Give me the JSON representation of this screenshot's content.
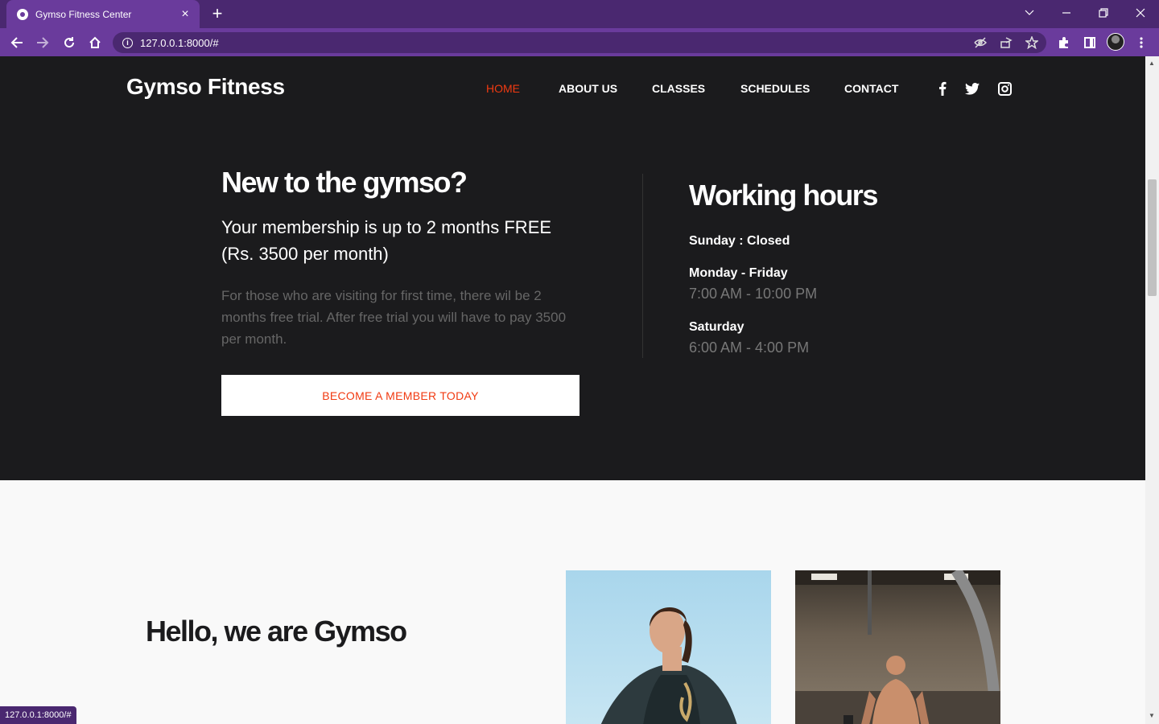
{
  "browser": {
    "tab_title": "Gymso Fitness Center",
    "tab_close": "×",
    "new_tab": "+",
    "url": "127.0.0.1:8000/#",
    "status_url": "127.0.0.1:8000/#"
  },
  "site": {
    "brand": "Gymso Fitness",
    "nav": [
      "HOME",
      "ABOUT US",
      "CLASSES",
      "SCHEDULES",
      "CONTACT"
    ],
    "active_nav": "HOME",
    "social": [
      "facebook-icon",
      "twitter-icon",
      "instagram-icon"
    ]
  },
  "hero": {
    "heading": "New to the gymso?",
    "membership_line1": "Your membership is up to 2 months FREE",
    "membership_line2": "(Rs. 3500 per month)",
    "trial_text": "For those who are visiting for first time, there wil be 2 months free trial. After free trial you will have to pay 3500 per month.",
    "cta_label": "BECOME A MEMBER TODAY"
  },
  "hours": {
    "heading": "Working hours",
    "sunday": "Sunday : Closed",
    "weekday_label": "Monday - Friday",
    "weekday_time": "7:00 AM - 10:00 PM",
    "saturday_label": "Saturday",
    "saturday_time": "6:00 AM - 4:00 PM"
  },
  "about": {
    "heading": "Hello, we are Gymso"
  },
  "colors": {
    "accent": "#f13a11",
    "hero_bg": "#1b1b1d",
    "browser_frame": "#6a3b9c"
  }
}
